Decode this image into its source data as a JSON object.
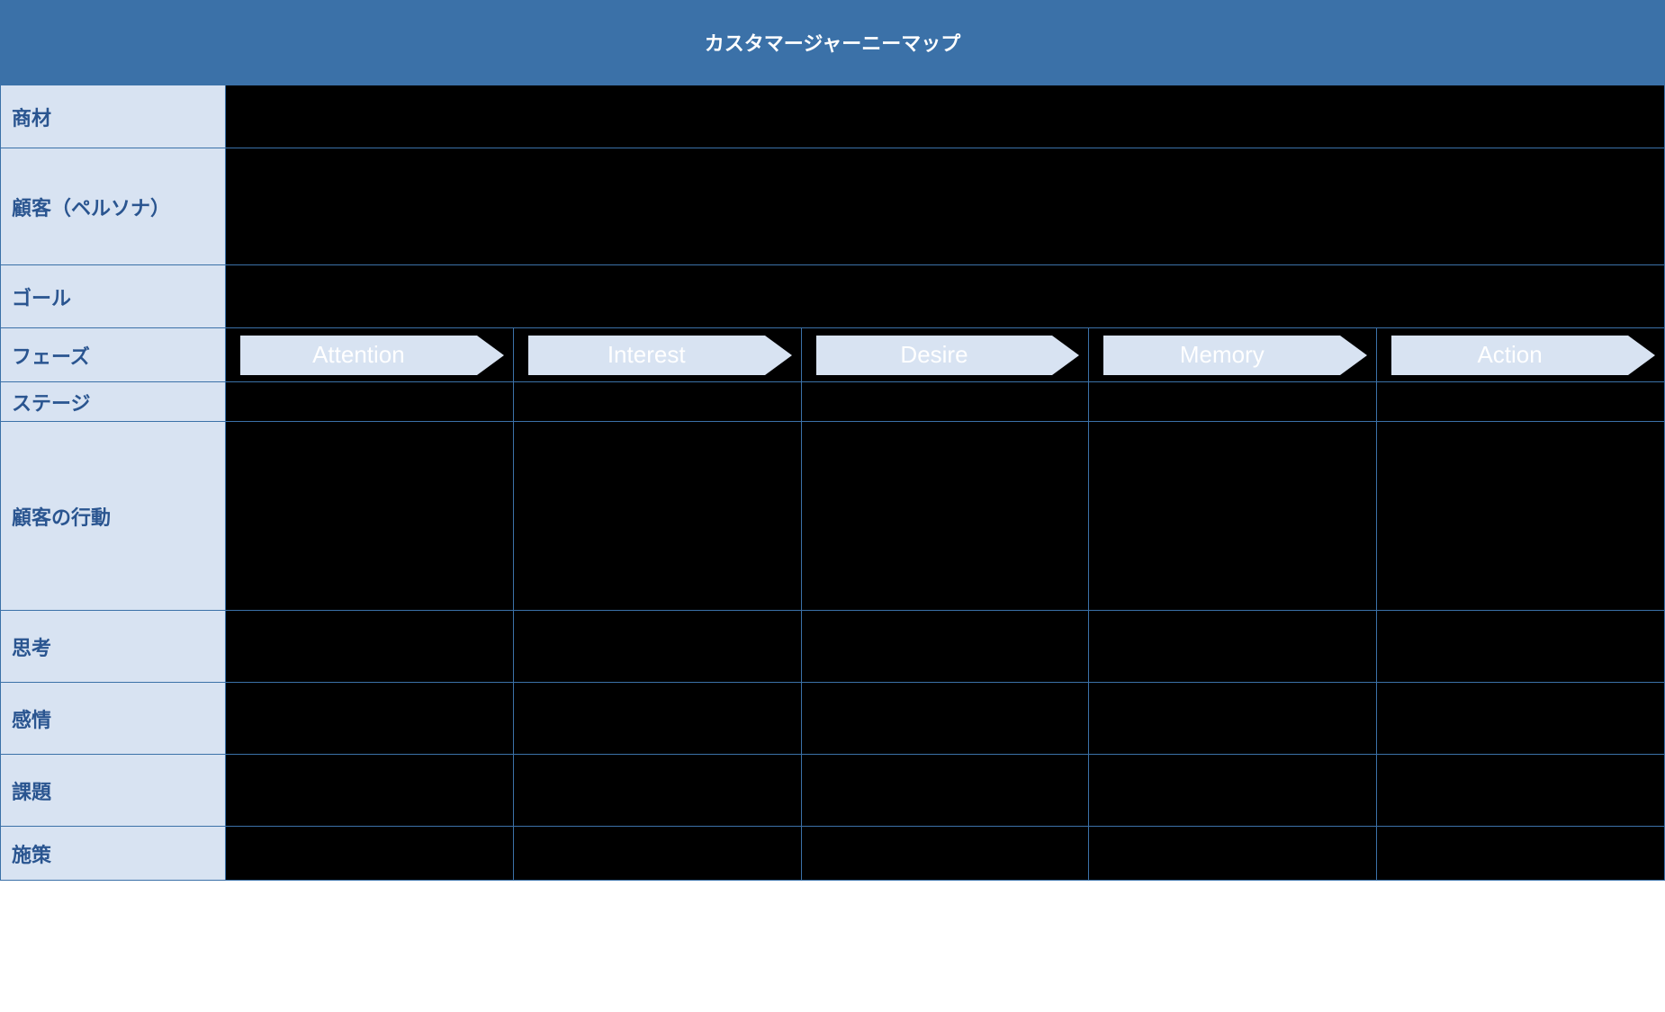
{
  "title": "カスタマージャーニーマップ",
  "rows": {
    "shozai": "商材",
    "persona": "顧客（ペルソナ）",
    "goal": "ゴール",
    "phase": "フェーズ",
    "stage": "ステージ",
    "action": "顧客の行動",
    "think": "思考",
    "emotion": "感情",
    "issue": "課題",
    "measure": "施策"
  },
  "phases": [
    "Attention",
    "Interest",
    "Desire",
    "Memory",
    "Action"
  ]
}
